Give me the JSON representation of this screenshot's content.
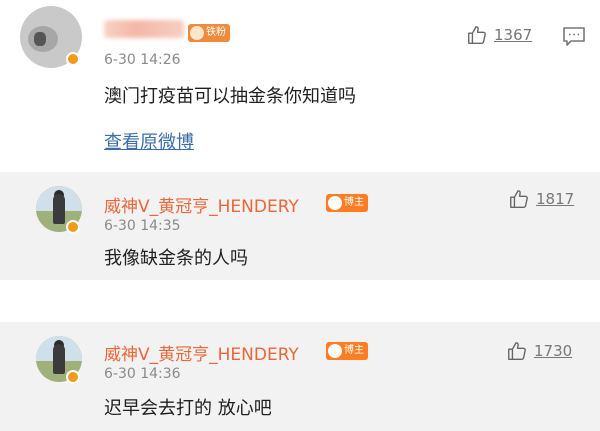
{
  "top_comment": {
    "time": "6-30 14:26",
    "badge": "铁粉",
    "likes": "1367",
    "text": "澳门打疫苗可以抽金条你知道吗",
    "link": "查看原微博"
  },
  "replies": [
    {
      "author": "威神V_黄冠亨_HENDERY",
      "badge": "博主",
      "time": "6-30 14:35",
      "likes": "1817",
      "text": "我像缺金条的人吗"
    },
    {
      "author": "威神V_黄冠亨_HENDERY",
      "badge": "博主",
      "time": "6-30 14:36",
      "likes": "1730",
      "text": "迟早会去打的 放心吧"
    }
  ],
  "colors": {
    "author": "#e8673a",
    "link": "#3d6da8",
    "reply_bg": "#f2f2f2",
    "badge": "#ff7d22"
  }
}
